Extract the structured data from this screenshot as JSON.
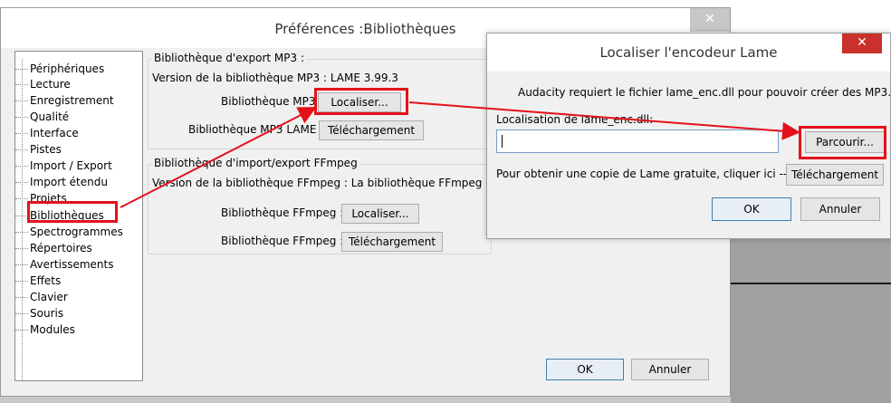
{
  "prefs": {
    "title": "Préférences :Bibliothèques",
    "close": "✕",
    "tree": [
      "Périphériques",
      "Lecture",
      "Enregistrement",
      "Qualité",
      "Interface",
      "Pistes",
      "Import / Export",
      "Import étendu",
      "Projets",
      "Bibliothèques",
      "Spectrogrammes",
      "Répertoires",
      "Avertissements",
      "Effets",
      "Clavier",
      "Souris",
      "Modules"
    ],
    "mp3_group": "Bibliothèque d'export MP3 :",
    "mp3_version": "Version de la bibliothèque MP3 : LAME 3.99.3",
    "mp3_lib_label": "Bibliothèque MP3",
    "mp3_locate": "Localiser...",
    "mp3_lame_label": "Bibliothèque MP3 LAME :",
    "mp3_download": "Téléchargement",
    "ff_group": "Bibliothèque d'import/export FFmpeg",
    "ff_version": "Version de la bibliothèque FFmpeg : La bibliothèque FFmpeg est a",
    "ff_lib_label1": "Bibliothèque FFmpeg :",
    "ff_locate": "Localiser...",
    "ff_lib_label2": "Bibliothèque FFmpeg :",
    "ff_download": "Téléchargement",
    "ok": "OK",
    "cancel": "Annuler"
  },
  "lame_dialog": {
    "title": "Localiser l'encodeur Lame",
    "close": "✕",
    "message": "Audacity requiert le fichier lame_enc.dll pour pouvoir créer des MP3.",
    "location_label": "Localisation de lame_enc.dll:",
    "location_value": "",
    "browse": "Parcourir...",
    "free_copy": "Pour obtenir une copie de Lame gratuite, cliquer ici -->",
    "download": "Téléchargement",
    "ok": "OK",
    "cancel": "Annuler"
  },
  "colors": {
    "highlight": "#e3121a",
    "close_red": "#c9312a"
  }
}
